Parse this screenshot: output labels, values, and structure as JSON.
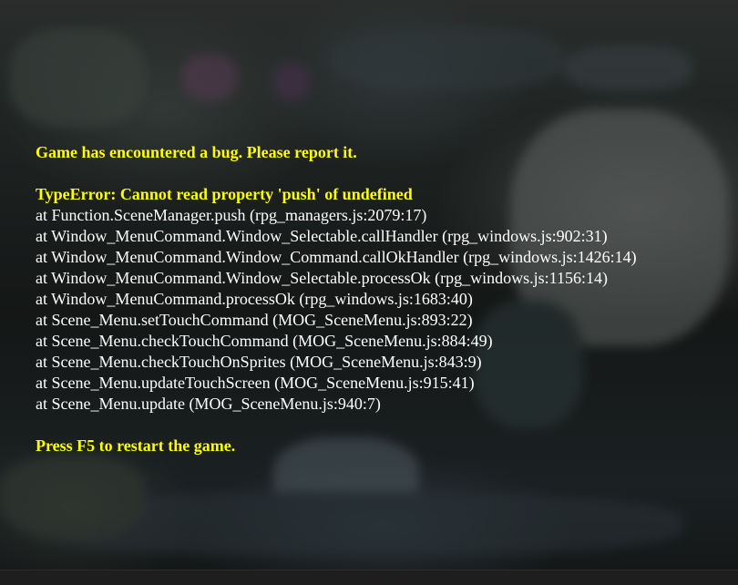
{
  "error": {
    "header": "Game has encountered a bug. Please report it.",
    "type_message": "TypeError: Cannot read property 'push' of undefined",
    "stack": [
      "at Function.SceneManager.push (rpg_managers.js:2079:17)",
      "at Window_MenuCommand.Window_Selectable.callHandler (rpg_windows.js:902:31)",
      "at Window_MenuCommand.Window_Command.callOkHandler (rpg_windows.js:1426:14)",
      "at Window_MenuCommand.Window_Selectable.processOk (rpg_windows.js:1156:14)",
      "at Window_MenuCommand.processOk (rpg_windows.js:1683:40)",
      "at Scene_Menu.setTouchCommand (MOG_SceneMenu.js:893:22)",
      "at Scene_Menu.checkTouchCommand (MOG_SceneMenu.js:884:49)",
      "at Scene_Menu.checkTouchOnSprites (MOG_SceneMenu.js:843:9)",
      "at Scene_Menu.updateTouchScreen (MOG_SceneMenu.js:915:41)",
      "at Scene_Menu.update (MOG_SceneMenu.js:940:7)"
    ],
    "footer": "Press F5 to restart the game."
  },
  "colors": {
    "highlight": "#ffff00",
    "text": "#ffffff",
    "background": "#0b0b0b"
  }
}
